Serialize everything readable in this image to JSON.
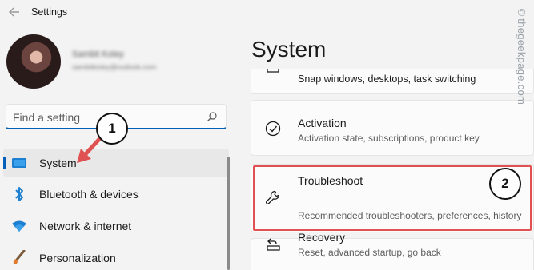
{
  "window": {
    "title": "Settings"
  },
  "profile": {
    "name": "Sambit Koley",
    "email": "sambitkoley@outlook.com"
  },
  "search": {
    "placeholder": "Find a setting"
  },
  "sidebar": {
    "items": [
      {
        "label": "System",
        "icon": "system-icon",
        "selected": true
      },
      {
        "label": "Bluetooth & devices",
        "icon": "bluetooth-icon"
      },
      {
        "label": "Network & internet",
        "icon": "wifi-icon"
      },
      {
        "label": "Personalization",
        "icon": "brush-icon"
      }
    ]
  },
  "main": {
    "title": "System",
    "cards": [
      {
        "title": "",
        "description": "Snap windows, desktops, task switching",
        "icon": "multitasking-icon"
      },
      {
        "title": "Activation",
        "description": "Activation state, subscriptions, product key",
        "icon": "activation-check-icon"
      },
      {
        "title": "Troubleshoot",
        "description": "Recommended troubleshooters, preferences, history",
        "icon": "wrench-icon"
      },
      {
        "title": "Recovery",
        "description": "Reset, advanced startup, go back",
        "icon": "recovery-icon"
      }
    ]
  },
  "annotations": {
    "step1": "1",
    "step2": "2",
    "highlight_color": "#e05252",
    "arrow_color": "#e05252"
  },
  "watermark": "©thegeekpage.com",
  "colors": {
    "accent": "#005fb8",
    "background": "#f3f3f3",
    "card": "#fbfbfb"
  }
}
